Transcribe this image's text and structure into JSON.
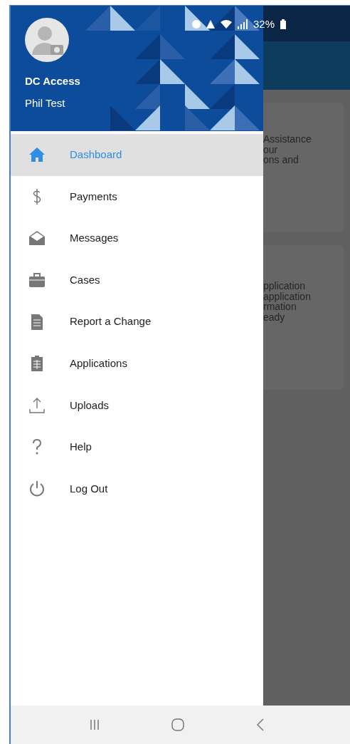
{
  "status_bar": {
    "battery": "32%"
  },
  "drawer": {
    "app_name": "DC Access",
    "user_name": "Phil Test",
    "items": [
      {
        "kind": "home",
        "label": "Dashboard",
        "selected": true
      },
      {
        "kind": "dollar",
        "label": "Payments",
        "selected": false
      },
      {
        "kind": "envelope",
        "label": "Messages",
        "selected": false
      },
      {
        "kind": "briefcase",
        "label": "Cases",
        "selected": false
      },
      {
        "kind": "document",
        "label": "Report a Change",
        "selected": false
      },
      {
        "kind": "clipboard",
        "label": "Applications",
        "selected": false
      },
      {
        "kind": "upload",
        "label": "Uploads",
        "selected": false
      },
      {
        "kind": "help",
        "label": "Help",
        "selected": false
      },
      {
        "kind": "power",
        "label": "Log Out",
        "selected": false
      }
    ]
  },
  "background_cards": [
    {
      "lines": [
        "Assistance",
        "our",
        "ons and"
      ]
    },
    {
      "lines": [
        "pplication",
        "application",
        "rmation",
        "eady"
      ]
    }
  ]
}
